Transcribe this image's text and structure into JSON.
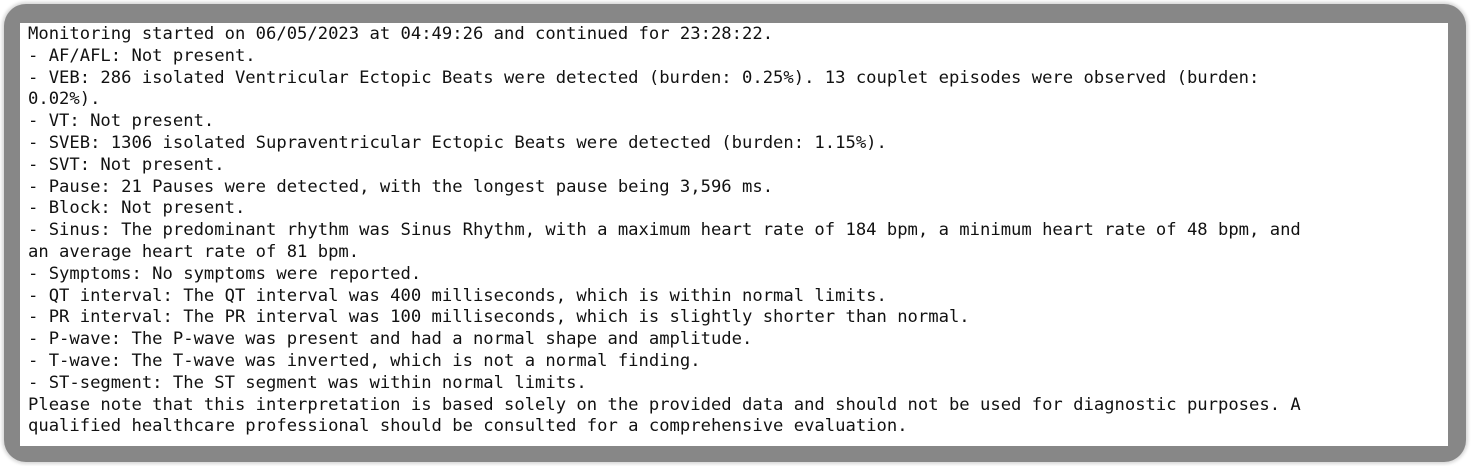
{
  "report": {
    "lines": [
      "Monitoring started on 06/05/2023 at 04:49:26 and continued for 23:28:22.",
      "- AF/AFL: Not present.",
      "- VEB: 286 isolated Ventricular Ectopic Beats were detected (burden: 0.25%). 13 couplet episodes were observed (burden:",
      "0.02%).",
      "- VT: Not present.",
      "- SVEB: 1306 isolated Supraventricular Ectopic Beats were detected (burden: 1.15%).",
      "- SVT: Not present.",
      "- Pause: 21 Pauses were detected, with the longest pause being 3,596 ms.",
      "- Block: Not present.",
      "- Sinus: The predominant rhythm was Sinus Rhythm, with a maximum heart rate of 184 bpm, a minimum heart rate of 48 bpm, and",
      "an average heart rate of 81 bpm.",
      "- Symptoms: No symptoms were reported.",
      "- QT interval: The QT interval was 400 milliseconds, which is within normal limits.",
      "- PR interval: The PR interval was 100 milliseconds, which is slightly shorter than normal.",
      "- P-wave: The P-wave was present and had a normal shape and amplitude.",
      "- T-wave: The T-wave was inverted, which is not a normal finding.",
      "- ST-segment: The ST segment was within normal limits.",
      "Please note that this interpretation is based solely on the provided data and should not be used for diagnostic purposes. A",
      "qualified healthcare professional should be consulted for a comprehensive evaluation."
    ]
  }
}
